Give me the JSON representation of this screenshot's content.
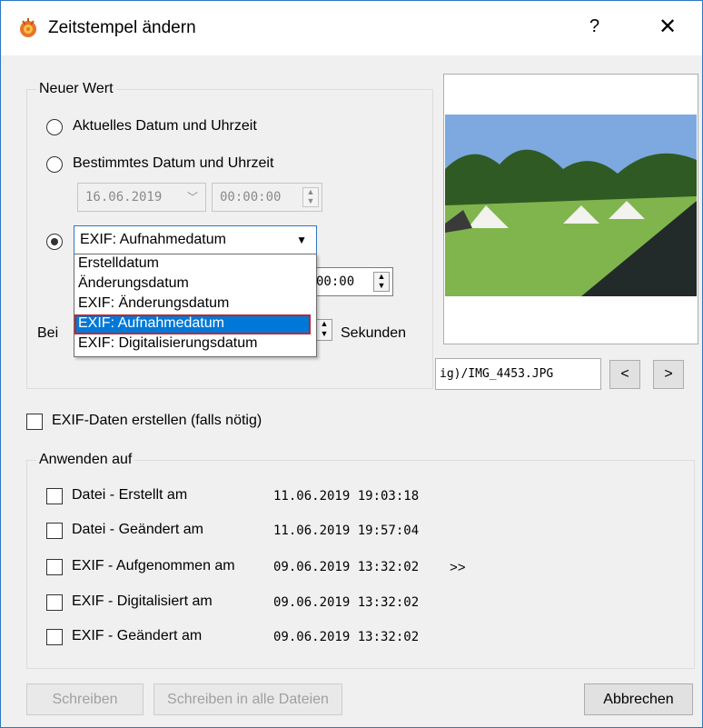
{
  "window": {
    "title": "Zeitstempel ändern",
    "help": "?",
    "close": "✕"
  },
  "new_value": {
    "label": "Neuer Wert",
    "opt_current": "Aktuelles Datum und Uhrzeit",
    "opt_specific": "Bestimmtes Datum und Uhrzeit",
    "date_value": "16.06.2019",
    "time_value": "00:00:00",
    "selected_source": "EXIF: Aufnahmedatum",
    "dropdown_options": [
      "Erstelldatum",
      "Änderungsdatum",
      "EXIF: Änderungsdatum",
      "EXIF: Aufnahmedatum",
      "EXIF: Digitalisierungsdatum"
    ],
    "behind_time": "00:00",
    "offset_prefix": "Bei",
    "offset_unit": "Sekunden"
  },
  "file": {
    "path": "ig)/IMG_4453.JPG",
    "prev": "<",
    "next": ">"
  },
  "create_exif": "EXIF-Daten erstellen (falls nötig)",
  "apply_to": {
    "label": "Anwenden auf",
    "rows": [
      {
        "label": "Datei - Erstellt am",
        "value": "11.06.2019 19:03:18",
        "extra": ""
      },
      {
        "label": "Datei - Geändert am",
        "value": "11.06.2019 19:57:04",
        "extra": ""
      },
      {
        "label": "EXIF - Aufgenommen am",
        "value": "09.06.2019 13:32:02",
        "extra": ">>"
      },
      {
        "label": "EXIF - Digitalisiert am",
        "value": "09.06.2019 13:32:02",
        "extra": ""
      },
      {
        "label": "EXIF - Geändert am",
        "value": "09.06.2019 13:32:02",
        "extra": ""
      }
    ]
  },
  "buttons": {
    "write": "Schreiben",
    "write_all": "Schreiben in alle Dateien",
    "cancel": "Abbrechen"
  },
  "colors": {
    "accent": "#0078d7",
    "highlight_border": "#c0262d"
  }
}
